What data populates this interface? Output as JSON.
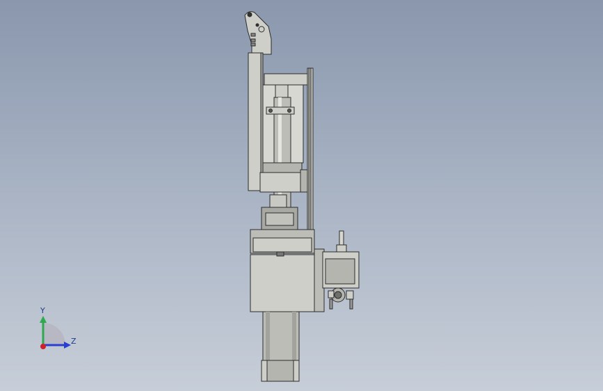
{
  "viewport": {
    "background_top": "#8a97ad",
    "background_bottom": "#c7ced8"
  },
  "model": {
    "body_fill": "#cfcfca",
    "body_stroke": "#2b2b2b",
    "shadow_fill": "#a9a9a4",
    "dark_fill": "#6e6e6b"
  },
  "triad": {
    "y_label": "Y",
    "z_label": "Z",
    "y_color": "#2fa84f",
    "z_color": "#2a3fd0",
    "x_color": "#d0202a",
    "arc_color": "#b8b8c4"
  }
}
